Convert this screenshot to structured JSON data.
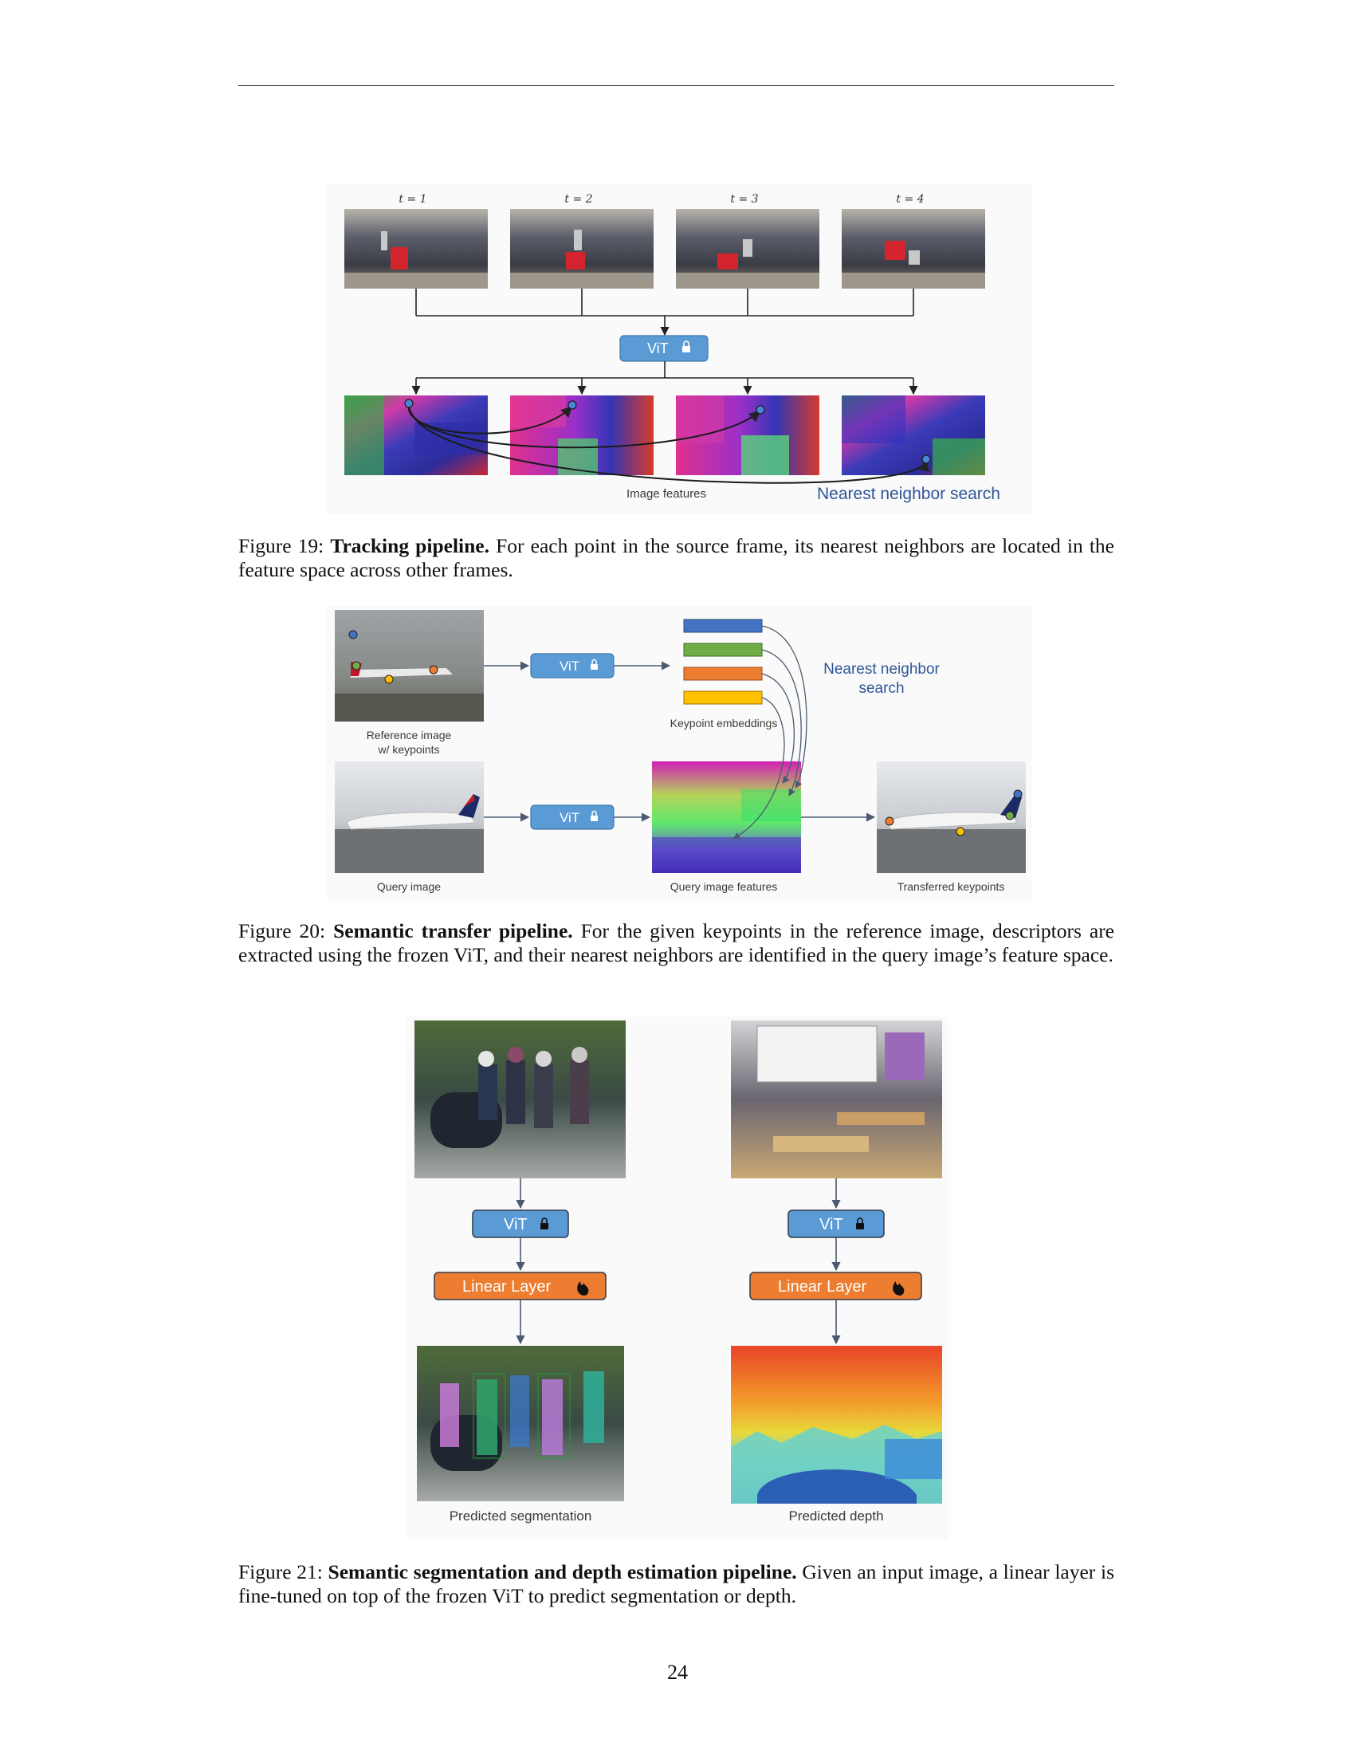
{
  "fig19": {
    "time_labels": [
      "t = 1",
      "t = 2",
      "t = 3",
      "t = 4"
    ],
    "vit_label": "ViT",
    "image_features_label": "Image features",
    "nn_label": "Nearest neighbor search",
    "caption_prefix": "Figure 19: ",
    "caption_title": "Tracking pipeline.",
    "caption_text": " For each point in the source frame, its nearest neighbors are located in the feature space across other frames."
  },
  "fig20": {
    "vit_label": "ViT",
    "reference_label_line1": "Reference image",
    "reference_label_line2": "w/ keypoints",
    "keypoint_embeddings_label": "Keypoint embeddings",
    "nn_line1": "Nearest neighbor",
    "nn_line2": "search",
    "query_label": "Query image",
    "query_features_label": "Query image features",
    "transferred_label": "Transferred keypoints",
    "embedding_colors": [
      "#4472c4",
      "#70ad47",
      "#ed7d31",
      "#ffc000"
    ],
    "caption_prefix": "Figure 20: ",
    "caption_title": "Semantic transfer pipeline.",
    "caption_text": " For the given keypoints in the reference image, descriptors are extracted using the frozen ViT, and their nearest neighbors are identified in the query image’s feature space."
  },
  "fig21": {
    "vit_label": "ViT",
    "linear_label": "Linear Layer",
    "seg_label": "Predicted segmentation",
    "depth_label": "Predicted depth",
    "caption_prefix": "Figure 21: ",
    "caption_title": "Semantic segmentation and depth estimation pipeline.",
    "caption_text": " Given an input image, a linear layer is fine-tuned on top of the frozen ViT to predict segmentation or depth."
  },
  "colors": {
    "vit_blue": "#5b9bd5",
    "linear_orange": "#ed7d31",
    "nn_text": "#2f5597"
  },
  "page_number": "24"
}
